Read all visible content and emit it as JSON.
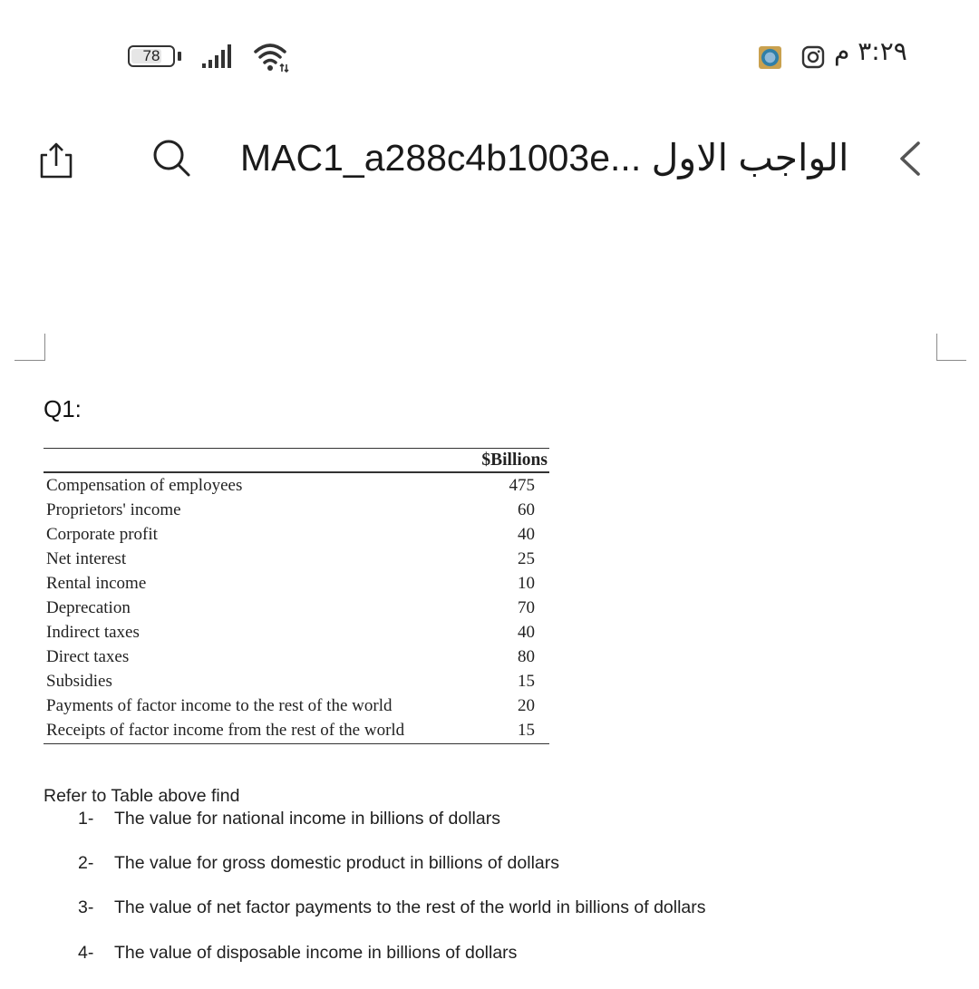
{
  "status_bar": {
    "battery_level": "78",
    "battery_percent": 78,
    "time": "٣:٢٩ م",
    "icons": [
      "battery-icon",
      "signal-icon",
      "wifi-icon",
      "app-badge-icon",
      "instagram-icon"
    ]
  },
  "toolbar": {
    "title": "MAC1_a288c4b1003e... الواجب الاول",
    "icons": [
      "share-icon",
      "search-icon",
      "back-chevron-icon"
    ]
  },
  "document": {
    "question_label": "Q1:",
    "table": {
      "column_header": "$Billions",
      "rows": [
        {
          "label": "Compensation of employees",
          "value": "475"
        },
        {
          "label": "Proprietors' income",
          "value": "60"
        },
        {
          "label": "Corporate profit",
          "value": "40"
        },
        {
          "label": "Net interest",
          "value": "25"
        },
        {
          "label": "Rental income",
          "value": "10"
        },
        {
          "label": "Deprecation",
          "value": "70"
        },
        {
          "label": "Indirect taxes",
          "value": "40"
        },
        {
          "label": "Direct taxes",
          "value": "80"
        },
        {
          "label": "Subsidies",
          "value": "15"
        },
        {
          "label": "Payments of factor income to the rest of the world",
          "value": "20"
        },
        {
          "label": "Receipts of factor income from the rest of the world",
          "value": "15"
        }
      ]
    },
    "instructions": "Refer to Table above find",
    "questions": [
      {
        "num": "1-",
        "text": "The value for national income in billions of dollars"
      },
      {
        "num": "2-",
        "text": "The value for gross domestic product in billions of dollars"
      },
      {
        "num": "3-",
        "text": "The value of net factor payments to the rest of the world in billions of dollars"
      },
      {
        "num": "4-",
        "text": "The value of disposable income in billions of dollars"
      }
    ]
  }
}
